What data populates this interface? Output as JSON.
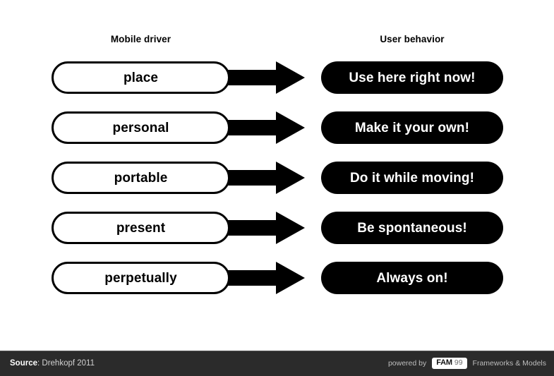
{
  "slide": {
    "background_color": "#ffffff",
    "columns": {
      "left_header": "Mobile driver",
      "right_header": "User behavior"
    },
    "rows": [
      {
        "driver": "place",
        "behavior": "Use here right now!"
      },
      {
        "driver": "personal",
        "behavior": "Make it your own!"
      },
      {
        "driver": "portable",
        "behavior": "Do it while moving!"
      },
      {
        "driver": "present",
        "behavior": "Be spontaneous!"
      },
      {
        "driver": "perpetually",
        "behavior": "Always on!"
      }
    ],
    "arrow_icon_name": "right-arrow-icon"
  },
  "footer": {
    "background_color": "#2b2b2b",
    "source_key": "Source",
    "source_separator": ":",
    "source_value": "Drehkopf 2011",
    "powered_by": "powered by",
    "logo": {
      "brand": "FAM",
      "number": "99",
      "background_color": "#ffffff"
    },
    "tagline": "Frameworks & Models"
  }
}
